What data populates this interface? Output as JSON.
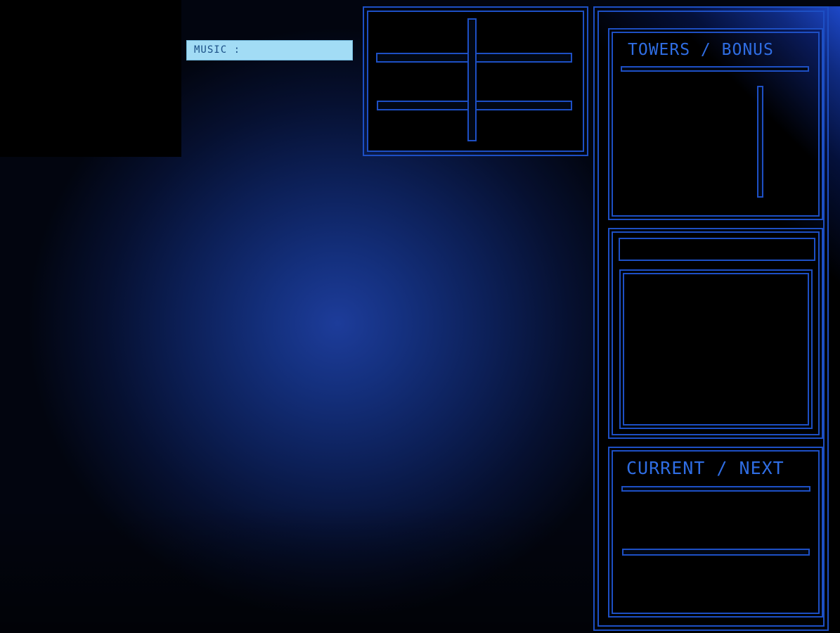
{
  "music_bar": {
    "label": "MUSIC :"
  },
  "controls_panel": {
    "layout": "two horizontal sliders crossed by a vertical slider"
  },
  "towers_panel": {
    "title": "TOWERS / BONUS"
  },
  "info_panel": {
    "header_text": ""
  },
  "current_panel": {
    "title": "CURRENT / NEXT"
  },
  "colors": {
    "frame": "#1d4fc4",
    "title": "#2f6de3",
    "music_bar_bg": "#a2dcf5",
    "music_bar_text": "#1a4f86",
    "background_center": "#1d3c9a"
  }
}
